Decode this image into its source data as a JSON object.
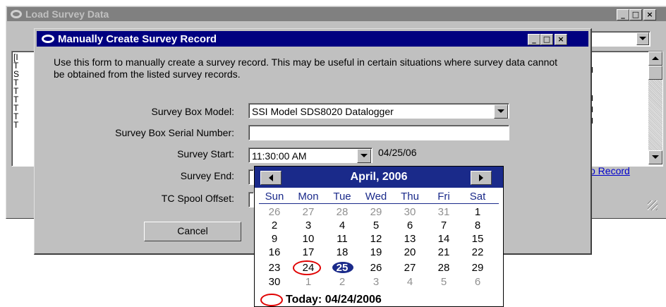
{
  "outer_window": {
    "title": "Load Survey Data",
    "title_icon": "app-logo-icon",
    "buttons": [
      "_",
      "□",
      "×"
    ],
    "list_fragment_letters": [
      "[I",
      "T",
      "S",
      "T",
      "T",
      "T",
      "T",
      "T",
      "T"
    ],
    "link_fragment": "o Record"
  },
  "dialog": {
    "title": "Manually Create Survey Record",
    "title_icon": "app-logo-icon",
    "buttons": [
      "_",
      "□",
      "×"
    ],
    "description": "Use this form to manually create a survey record.  This may be useful in certain situations where survey data cannot be obtained from the listed survey records.",
    "fields": {
      "box_model_label": "Survey Box Model:",
      "box_model_value": "SSI Model SDS8020 Datalogger",
      "serial_label": "Survey Box Serial Number:",
      "serial_value": "",
      "start_label": "Survey Start:",
      "start_time": "11:30:00 AM",
      "start_date": "04/25/06",
      "end_label": "Survey End:",
      "offset_label": "TC Spool Offset:"
    },
    "cancel_label": "Cancel"
  },
  "calendar": {
    "month_title": "April, 2006",
    "days_of_week": [
      "Sun",
      "Mon",
      "Tue",
      "Wed",
      "Thu",
      "Fri",
      "Sat"
    ],
    "weeks": [
      [
        "26",
        "27",
        "28",
        "29",
        "30",
        "31",
        "1"
      ],
      [
        "2",
        "3",
        "4",
        "5",
        "6",
        "7",
        "8"
      ],
      [
        "9",
        "10",
        "11",
        "12",
        "13",
        "14",
        "15"
      ],
      [
        "16",
        "17",
        "18",
        "19",
        "20",
        "21",
        "22"
      ],
      [
        "23",
        "24",
        "25",
        "26",
        "27",
        "28",
        "29"
      ],
      [
        "30",
        "1",
        "2",
        "3",
        "4",
        "5",
        "6"
      ]
    ],
    "selected_day": "25",
    "today_day": "24",
    "today_text": "Today: 04/24/2006",
    "colors": {
      "header": "#1a2a8a",
      "today_ring": "#e00000",
      "other_month": "#909090"
    }
  }
}
